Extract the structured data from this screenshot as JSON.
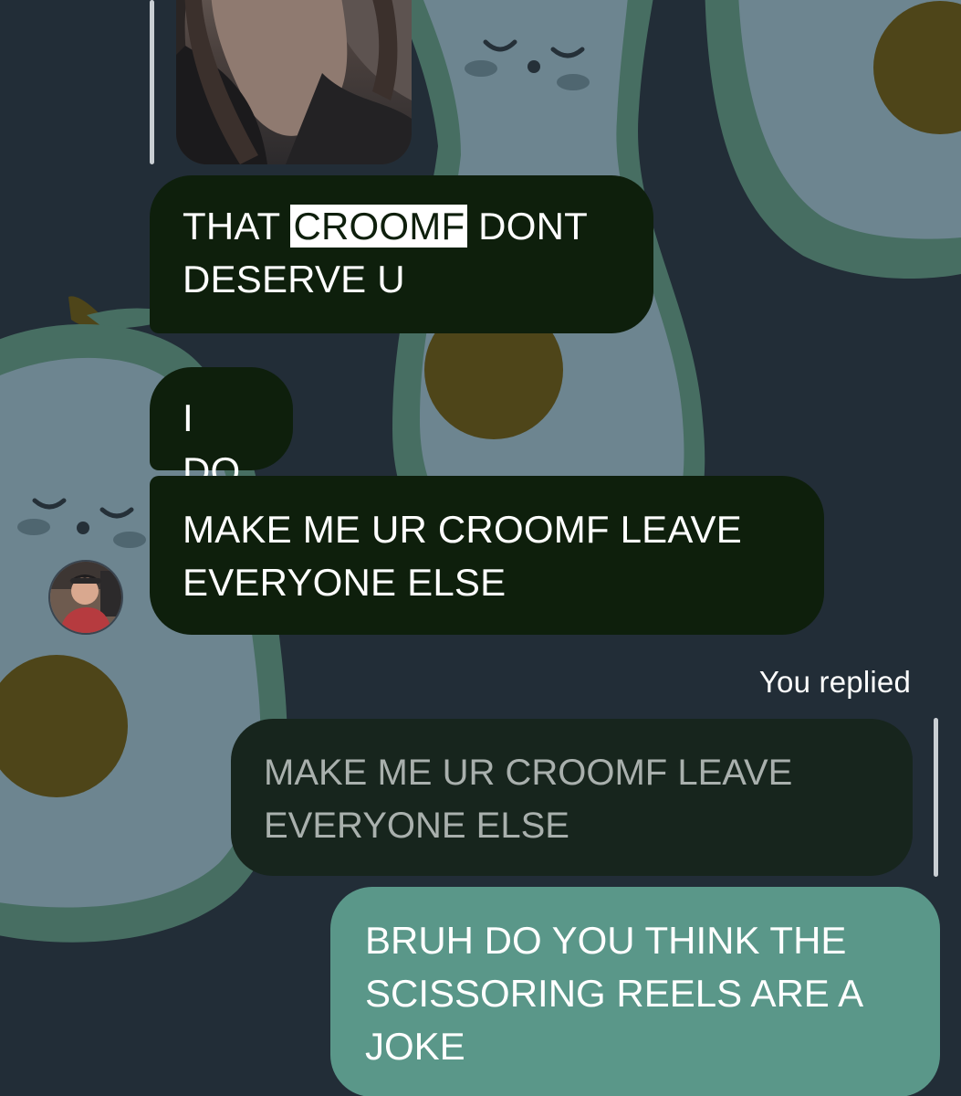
{
  "thread": {
    "messages": [
      {
        "sender": "them",
        "text_before": "THAT ",
        "highlighted": "CROOMF",
        "text_after": " DONT DESERVE U"
      },
      {
        "sender": "them",
        "text": "I DO"
      },
      {
        "sender": "them",
        "text": "MAKE ME UR CROOMF LEAVE EVERYONE ELSE"
      }
    ],
    "reply_label": "You replied",
    "quoted_text": "MAKE ME UR CROOMF LEAVE EVERYONE ELSE",
    "outgoing_text": "BRUH DO YOU THINK THE SCISSORING REELS ARE A JOKE"
  },
  "colors": {
    "background": "#222d37",
    "incoming_bubble": "#0e1f0c",
    "outgoing_bubble": "#5a9789",
    "quoted_bubble": "#17251d",
    "avocado_skin": "#476e62",
    "avocado_flesh": "#6d8590",
    "avocado_pit": "#4e4519"
  },
  "icons": {
    "avatar": "user-avatar-photo",
    "shared_image": "shared-photo-attachment",
    "wallpaper": "avocado-pattern"
  }
}
